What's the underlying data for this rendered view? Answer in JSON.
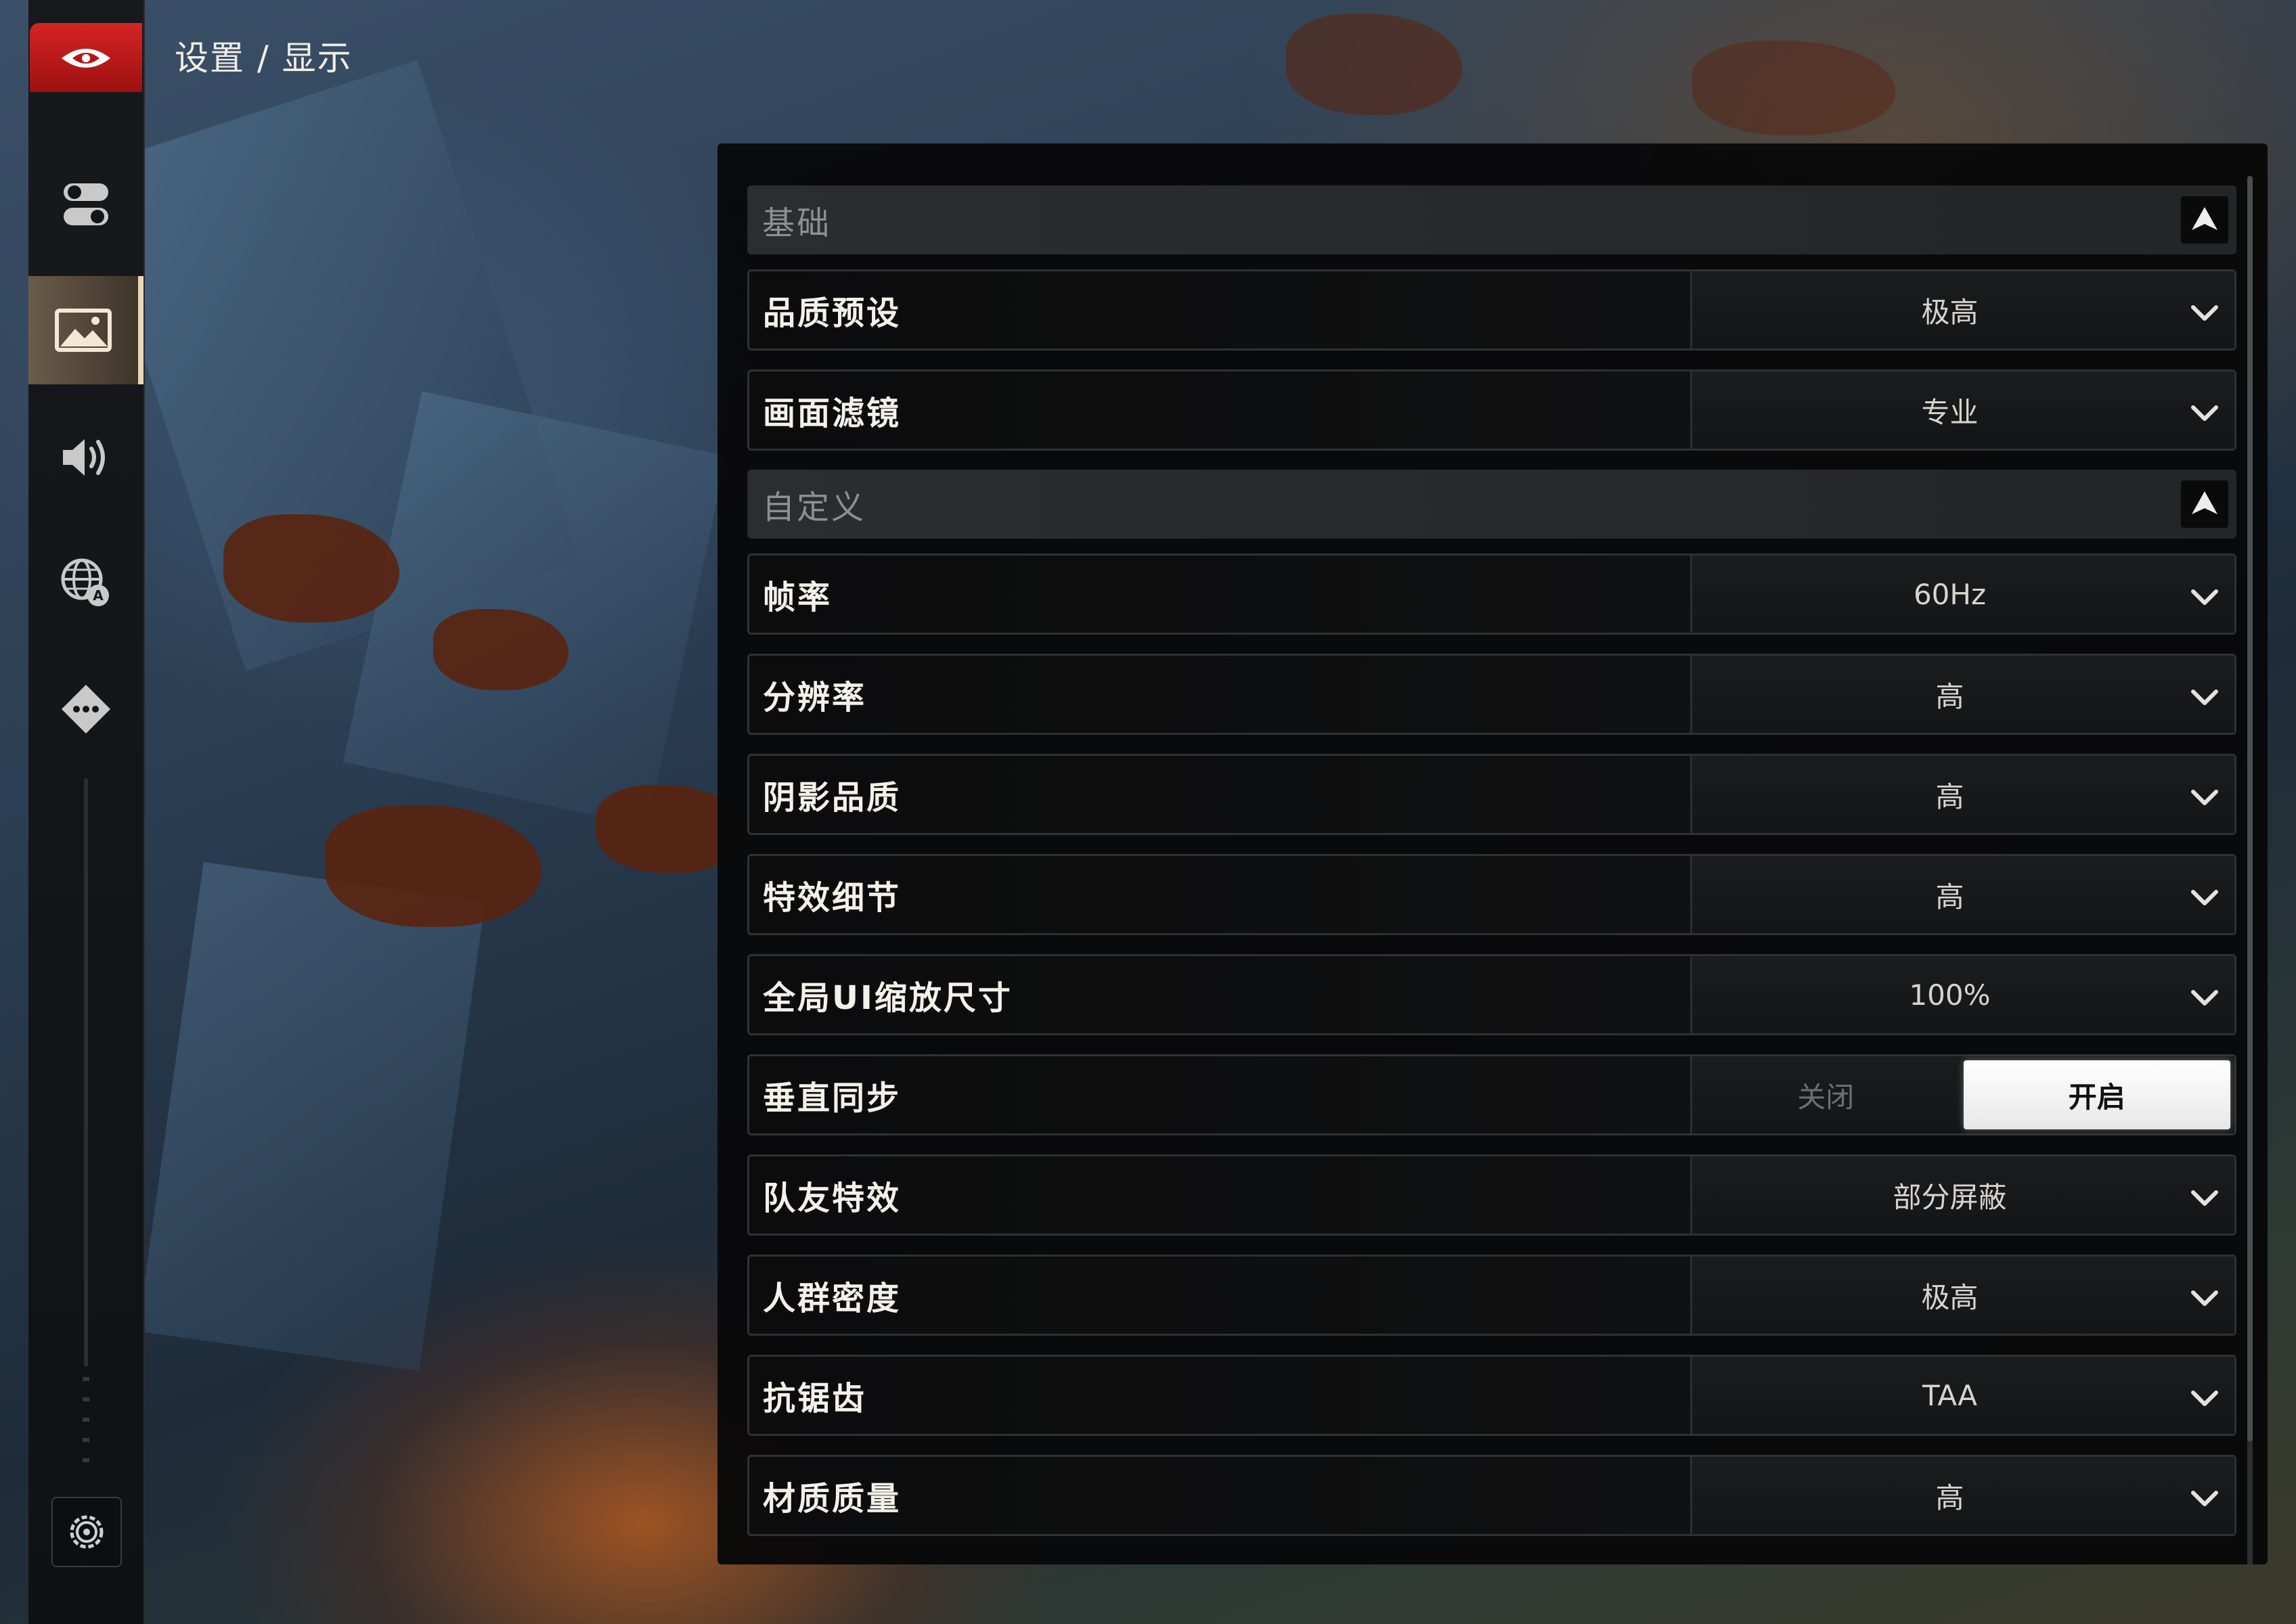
{
  "breadcrumb": "设置 / 显示",
  "sidebar": {
    "items": [
      {
        "icon": "toggles-icon",
        "active": false
      },
      {
        "icon": "picture-icon",
        "active": true
      },
      {
        "icon": "speaker-icon",
        "active": false
      },
      {
        "icon": "globe-language-icon",
        "active": false
      },
      {
        "icon": "gamepad-dpad-icon",
        "active": false
      }
    ],
    "bottom_icon": "gear-icon"
  },
  "sections": [
    {
      "title": "基础",
      "rows": [
        {
          "label": "品质预设",
          "value": "极高"
        },
        {
          "label": "画面滤镜",
          "value": "专业"
        }
      ]
    },
    {
      "title": "自定义",
      "rows": [
        {
          "label": "帧率",
          "value": "60Hz"
        },
        {
          "label": "分辨率",
          "value": "高"
        },
        {
          "label": "阴影品质",
          "value": "高"
        },
        {
          "label": "特效细节",
          "value": "高"
        },
        {
          "label": "全局UI缩放尺寸",
          "value": "100%"
        },
        {
          "label": "垂直同步",
          "toggle": {
            "off": "关闭",
            "on": "开启",
            "selected": "on"
          }
        },
        {
          "label": "队友特效",
          "value": "部分屏蔽"
        },
        {
          "label": "人群密度",
          "value": "极高"
        },
        {
          "label": "抗锯齿",
          "value": "TAA"
        },
        {
          "label": "材质质量",
          "value": "高"
        }
      ]
    }
  ],
  "colors": {
    "accent_red": "#c81c1c",
    "active_highlight": "#e9d7b5",
    "panel": "#080809"
  }
}
